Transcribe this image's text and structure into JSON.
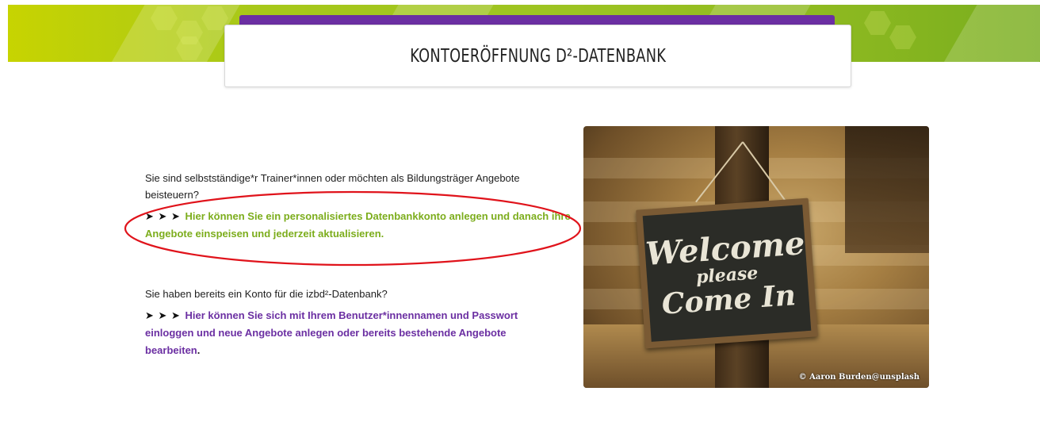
{
  "header": {
    "title": "KONTOERÖFFNUNG D²-DATENBANK"
  },
  "section1": {
    "question": "Sie sind selbstständige*r Trainer*innen oder möchten als Bildungsträger Angebote beisteuern?",
    "arrows": "➤ ➤ ➤",
    "link": "Hier können Sie ein personalisiertes Datenbankkonto anlegen und danach ihre Angebote einspeisen und jederzeit aktualisieren."
  },
  "section2": {
    "question": "Sie haben bereits ein Konto für die izbd²-Datenbank?",
    "arrows": "➤ ➤ ➤",
    "link": "Hier können Sie sich mit Ihrem Benutzer*innennamen und Passwort einloggen und neue Angebote anlegen oder bereits bestehende Angebote bearbeiten",
    "suffix": "."
  },
  "image": {
    "chalk_line1": "Welcome",
    "chalk_line2": "please",
    "chalk_line3": "Come In",
    "credit": "© Aaron Burden@unsplash"
  },
  "colors": {
    "accent_purple": "#6b2fa2",
    "link_green": "#7cad1c",
    "annotation_red": "#e0131b"
  }
}
